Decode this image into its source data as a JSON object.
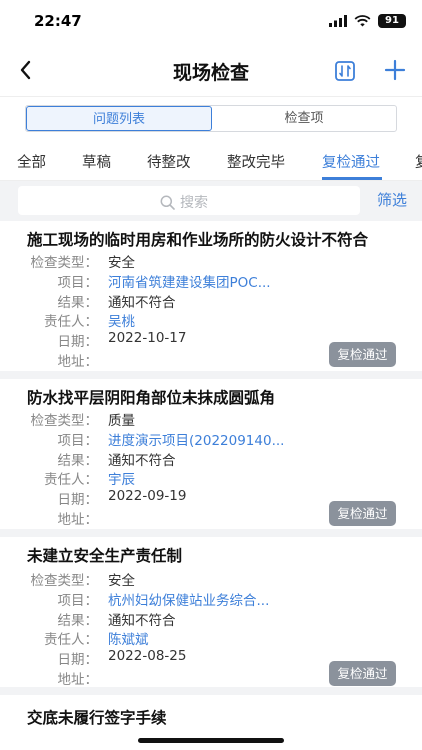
{
  "status_bar": {
    "time": "22:47",
    "battery": "91"
  },
  "nav": {
    "title": "现场检查"
  },
  "segment": {
    "items": [
      "问题列表",
      "检查项"
    ]
  },
  "tabs": [
    "全部",
    "草稿",
    "待整改",
    "整改完毕",
    "复检通过",
    "复"
  ],
  "search": {
    "placeholder": "搜索",
    "filter_label": "筛选"
  },
  "labels": {
    "type": "检查类型：",
    "project": "项目：",
    "result": "结果：",
    "owner": "责任人：",
    "date": "日期：",
    "address": "地址："
  },
  "cards": [
    {
      "title": "施工现场的临时用房和作业场所的防火设计不符合",
      "type": "安全",
      "project": "河南省筑建建设集团POC...",
      "result": "通知不符合",
      "owner": "吴桃",
      "date": "2022-10-17",
      "address": "",
      "status": "复检通过"
    },
    {
      "title": "防水找平层阴阳角部位未抹成圆弧角",
      "type": "质量",
      "project": "进度演示项目(202209140...",
      "result": "通知不符合",
      "owner": "宇辰",
      "date": "2022-09-19",
      "address": "",
      "status": "复检通过"
    },
    {
      "title": "未建立安全生产责任制",
      "type": "安全",
      "project": "杭州妇幼保健站业务综合...",
      "result": "通知不符合",
      "owner": "陈斌斌",
      "date": "2022-08-25",
      "address": "",
      "status": "复检通过"
    },
    {
      "title": "交底未履行签字手续"
    }
  ],
  "colors": {
    "accent": "#3d7fd9",
    "status_badge": "#8b929c"
  }
}
